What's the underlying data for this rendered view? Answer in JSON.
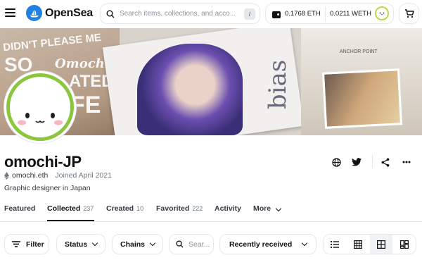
{
  "header": {
    "brand": "OpenSea",
    "search_placeholder": "Search items, collections, and acco...",
    "search_shortcut": "/",
    "eth_balance": "0.1768 ETH",
    "weth_balance": "0.0211 WETH"
  },
  "banner": {
    "panel1_words": [
      "DIDN'T PLEASE ME",
      "SO",
      "Omochi",
      "ATED",
      "FE"
    ],
    "panel2_word": "bias",
    "panel3_title": "ANCHOR POINT"
  },
  "profile": {
    "name": "omochi-JP",
    "ens": "omochi.eth",
    "joined": "Joined April 2021",
    "bio": "Graphic designer in Japan"
  },
  "tabs": [
    {
      "label": "Featured",
      "count": ""
    },
    {
      "label": "Collected",
      "count": "237"
    },
    {
      "label": "Created",
      "count": "10"
    },
    {
      "label": "Favorited",
      "count": "222"
    },
    {
      "label": "Activity",
      "count": ""
    },
    {
      "label": "More",
      "count": ""
    }
  ],
  "filters": {
    "filter_label": "Filter",
    "status_label": "Status",
    "chains_label": "Chains",
    "search_placeholder": "Sear...",
    "sort_label": "Recently received"
  },
  "colors": {
    "brand_blue": "#2081e2",
    "avatar_ring": "#b7d94a",
    "text_primary": "#121212",
    "border": "#e5e8eb"
  },
  "icons": [
    "menu-icon",
    "opensea-logo-icon",
    "search-icon",
    "wallet-icon",
    "cart-icon",
    "globe-icon",
    "twitter-icon",
    "share-icon",
    "more-icon",
    "ethereum-icon",
    "filter-icon",
    "chevron-down-icon",
    "list-view-icon",
    "grid-large-icon",
    "grid-small-icon",
    "mosaic-view-icon"
  ]
}
